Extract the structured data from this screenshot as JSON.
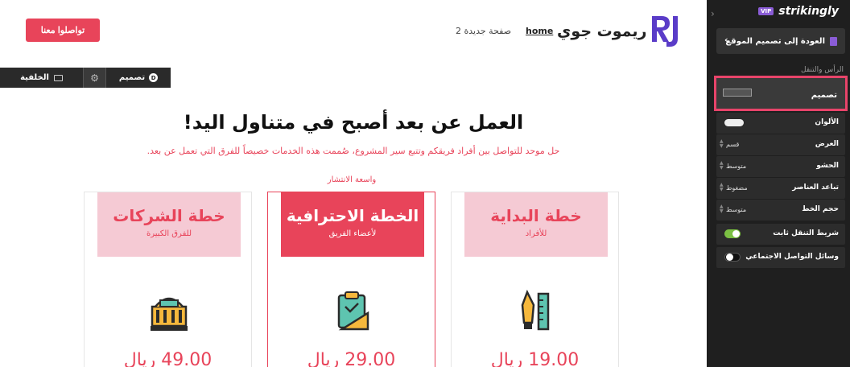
{
  "canvas": {
    "contact_button": "تواصلوا معنا",
    "site_name": "ريموت جوي",
    "nav": {
      "home": "home",
      "page": "صفحة جديدة 2"
    },
    "toolbar": {
      "background": "الخلفية",
      "design": "تصميم",
      "design_badge": "D"
    },
    "headline": "العمل عن بعد أصبح في متناول اليد!",
    "subheadline": "حل موحد للتواصل بين أفراد فريقكم وتتبع سير المشروع، صُممت هذه الخدمات خصيصاً للفرق التي تعمل عن بعد.",
    "popular_label": "واسعة الانتشار",
    "plans": [
      {
        "title": "خطة الشركات",
        "subtitle": "للفرق الكبيرة",
        "price": "49.00 ريال",
        "icon": "building-icon"
      },
      {
        "title": "الخطة الاحترافية",
        "subtitle": "لأعضاء الفريق",
        "price": "29.00 ريال",
        "icon": "clipboard-icon"
      },
      {
        "title": "خطة البداية",
        "subtitle": "للأفراد",
        "price": "19.00 ريال",
        "icon": "pen-ruler-icon"
      }
    ]
  },
  "sidebar": {
    "brand": "strikingly",
    "vip": "VIP",
    "back_button": "العودة إلى تصميم الموقع",
    "section_title": "الرأس والتنقل",
    "design_label": "تصميم",
    "rows": {
      "colors": {
        "label": "الألوان"
      },
      "width": {
        "label": "العرض",
        "value": "قسم"
      },
      "padding": {
        "label": "الحشو",
        "value": "متوسط"
      },
      "spacing": {
        "label": "تباعد العناصر",
        "value": "مضغوط"
      },
      "font_size": {
        "label": "حجم الخط",
        "value": "متوسط"
      },
      "fixed_nav": {
        "label": "شريط التنقل ثابت",
        "on": true
      },
      "social": {
        "label": "وسائل التواصل الاجتماعي",
        "on": false
      }
    }
  },
  "colors": {
    "accent": "#e8445a",
    "pink_light": "#f5cad4",
    "sidebar_bg": "#1f1f1f",
    "vip": "#8a5cd6",
    "toggle_on": "#7bc043"
  }
}
